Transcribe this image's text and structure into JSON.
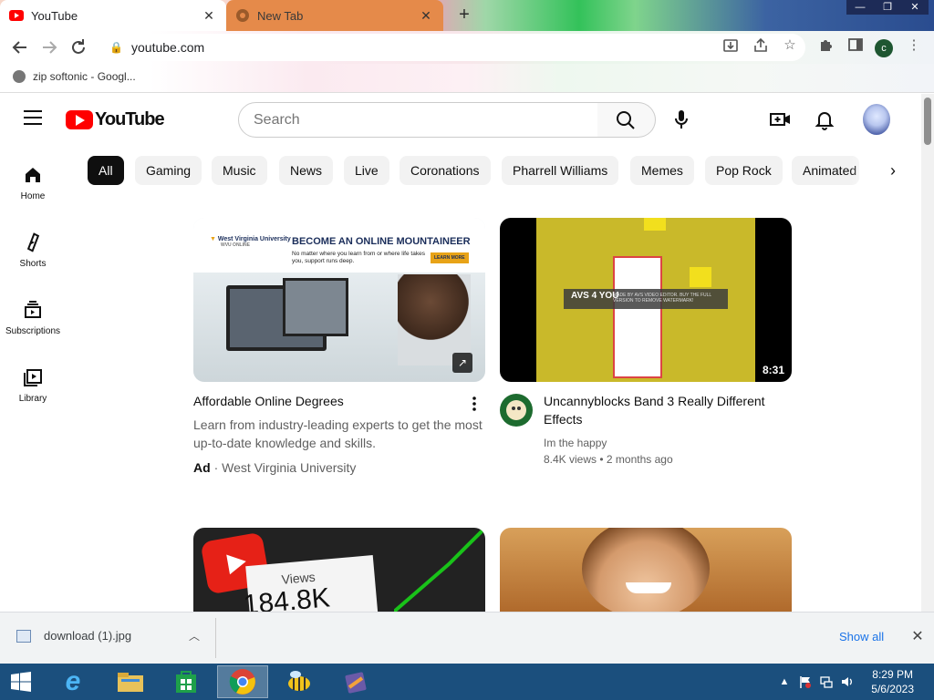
{
  "browser": {
    "tabs": [
      {
        "label": "YouTube"
      },
      {
        "label": "New Tab"
      }
    ],
    "new_tab_symbol": "+",
    "url": "youtube.com",
    "profile_initial": "c",
    "bookmark": {
      "label": "zip softonic - Googl..."
    }
  },
  "header": {
    "search_placeholder": "Search"
  },
  "chips": [
    "All",
    "Gaming",
    "Music",
    "News",
    "Live",
    "Coronations",
    "Pharrell Williams",
    "Memes",
    "Pop Rock",
    "Animated"
  ],
  "guide": [
    {
      "label": "Home",
      "icon": "home-icon"
    },
    {
      "label": "Shorts",
      "icon": "shorts-icon"
    },
    {
      "label": "Subscriptions",
      "icon": "subscriptions-icon"
    },
    {
      "label": "Library",
      "icon": "library-icon"
    }
  ],
  "videos": {
    "ad": {
      "thumb_brand": "West Virginia University",
      "thumb_sub": "WVU ONLINE",
      "thumb_headline": "BECOME AN ONLINE MOUNTAINEER",
      "thumb_body": "No matter where you learn from or where life takes you, support runs deep.",
      "thumb_cta": "LEARN MORE",
      "title": "Affordable Online Degrees",
      "description": "Learn from industry-leading experts to get the most up-to-date knowledge and skills.",
      "ad_label": "Ad",
      "advertiser": "West Virginia University"
    },
    "second": {
      "title": "Uncannyblocks Band 3 Really Different Effects",
      "channel": "Im the happy",
      "views": "8.4K views",
      "age": "2 months ago",
      "duration": "8:31",
      "watermark": "MADE BY AVS VIDEO EDITOR. BUY THE FULL VERSION TO REMOVE WATERMARK!"
    },
    "third": {
      "thumb_text_views": "Views",
      "thumb_text_count": "184.8K"
    }
  },
  "downloads": {
    "file": "download (1).jpg",
    "show_all": "Show all"
  },
  "taskbar": {
    "time": "8:29 PM",
    "date": "5/6/2023"
  },
  "colors": {
    "youtube_red": "#ff0000",
    "chip_active": "#0f0f0f",
    "link_blue": "#1a73e8",
    "taskbar": "#1b4f7d"
  }
}
